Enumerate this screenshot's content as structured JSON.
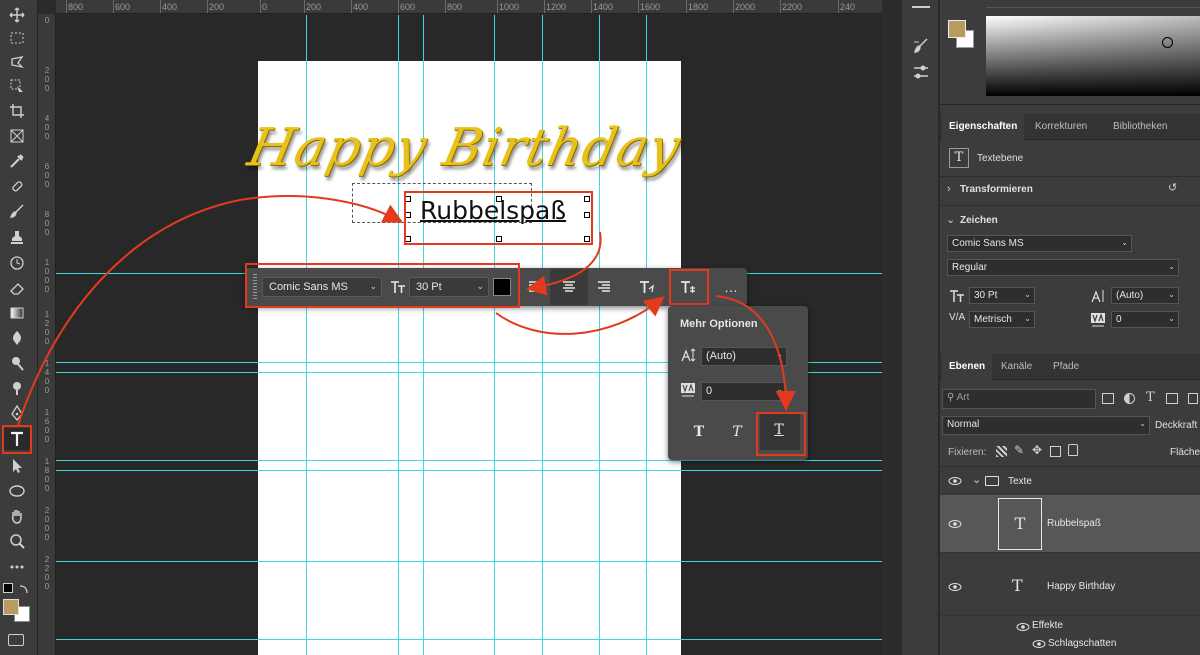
{
  "ruler": {
    "h_labels": [
      "800",
      "600",
      "400",
      "200",
      "0",
      "200",
      "400",
      "600",
      "800",
      "1000",
      "1200",
      "1400",
      "1600",
      "1800",
      "2000",
      "2200",
      "240"
    ],
    "v_labels": [
      "0",
      "2 0 0",
      "4 0 0",
      "6 0 0",
      "8 0 0",
      "1 0 0 0",
      "1 2 0 0",
      "1 4 0 0",
      "1 6 0 0",
      "1 8 0 0",
      "2 0 0 0",
      "2 2 0 0"
    ]
  },
  "canvas": {
    "heading_text": "Happy Birthday",
    "selected_text": "Rubbelspaß",
    "heading_color": "#e8c21a"
  },
  "taskbar": {
    "font_family": "Comic Sans MS",
    "font_size": "30 Pt",
    "text_color": "#000000",
    "more_label": "…"
  },
  "more_options": {
    "title": "Mehr Optionen",
    "leading": "(Auto)",
    "tracking": "0"
  },
  "properties": {
    "tabs": [
      "Eigenschaften",
      "Korrekturen",
      "Bibliotheken"
    ],
    "layer_type": "Textebene",
    "transform_label": "Transformieren",
    "character_label": "Zeichen",
    "font_family": "Comic Sans MS",
    "font_style": "Regular",
    "font_size": "30 Pt",
    "leading": "(Auto)",
    "kerning": "Metrisch",
    "tracking": "0"
  },
  "layers": {
    "tabs": [
      "Ebenen",
      "Kanäle",
      "Pfade"
    ],
    "filter_placeholder": "Art",
    "blend_mode": "Normal",
    "opacity_label": "Deckkraft",
    "lock_label": "Fixieren:",
    "fill_label": "Fläche",
    "items": [
      {
        "name": "Texte",
        "kind": "group"
      },
      {
        "name": "Rubbelspaß",
        "kind": "text"
      },
      {
        "name": "Happy Birthday",
        "kind": "text"
      }
    ],
    "effects_label": "Effekte",
    "effect_item": "Schlagschatten"
  },
  "colors": {
    "foreground": "#b89a63",
    "background": "#ffffff",
    "guide": "#3fd7e0",
    "highlight": "#e33a1e"
  }
}
